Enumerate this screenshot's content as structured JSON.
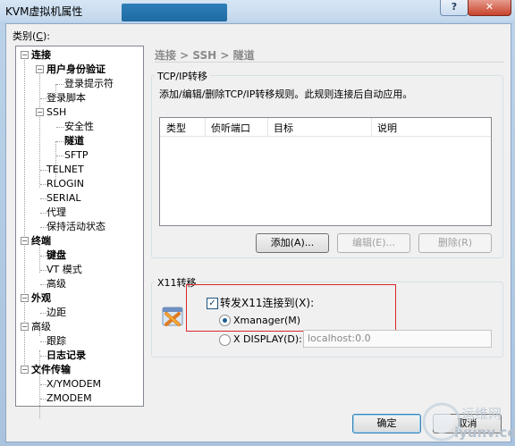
{
  "window": {
    "title": "KVM虚拟机属性",
    "help_label": "?",
    "close_label": "✕"
  },
  "category": {
    "label_prefix": "类别(",
    "label_key": "C",
    "label_suffix": "):"
  },
  "tree": {
    "connection": "连接",
    "auth": "用户身份验证",
    "login_prompt": "登录提示符",
    "login_script": "登录脚本",
    "ssh": "SSH",
    "security": "安全性",
    "tunnel": "隧道",
    "sftp": "SFTP",
    "telnet": "TELNET",
    "rlogin": "RLOGIN",
    "serial": "SERIAL",
    "proxy": "代理",
    "keepalive": "保持活动状态",
    "terminal": "终端",
    "keyboard": "键盘",
    "vt_mode": "VT 模式",
    "term_advanced": "高级",
    "appearance": "外观",
    "margin": "边距",
    "advanced": "高级",
    "trace": "跟踪",
    "logging": "日志记录",
    "file_transfer": "文件传输",
    "xymodem": "X/YMODEM",
    "zmodem": "ZMODEM"
  },
  "breadcrumb": "连接 > SSH > 隧道",
  "tcp_group": {
    "title": "TCP/IP转移",
    "description": "添加/编辑/删除TCP/IP转移规则。此规则连接后自动应用。",
    "columns": [
      "类型",
      "侦听端口",
      "目标",
      "说明"
    ],
    "add_button": "添加(A)...",
    "edit_button": "编辑(E)...",
    "delete_button": "删除(R)"
  },
  "x11_group": {
    "title": "X11转移",
    "forward_label": "转发X11连接到(X):",
    "forward_checked": true,
    "xmanager_label": "Xmanager(M)",
    "xdisplay_label": "X DISPLAY(D):",
    "display_value": "localhost:0.0",
    "selected": "Xmanager"
  },
  "buttons": {
    "ok": "确定",
    "cancel": "取消"
  },
  "watermark": {
    "text1": "运维网",
    "text2": "iyunv.com"
  },
  "colors": {
    "highlight_box": "#d9262b",
    "title_gradient": "#c2d7ec"
  }
}
